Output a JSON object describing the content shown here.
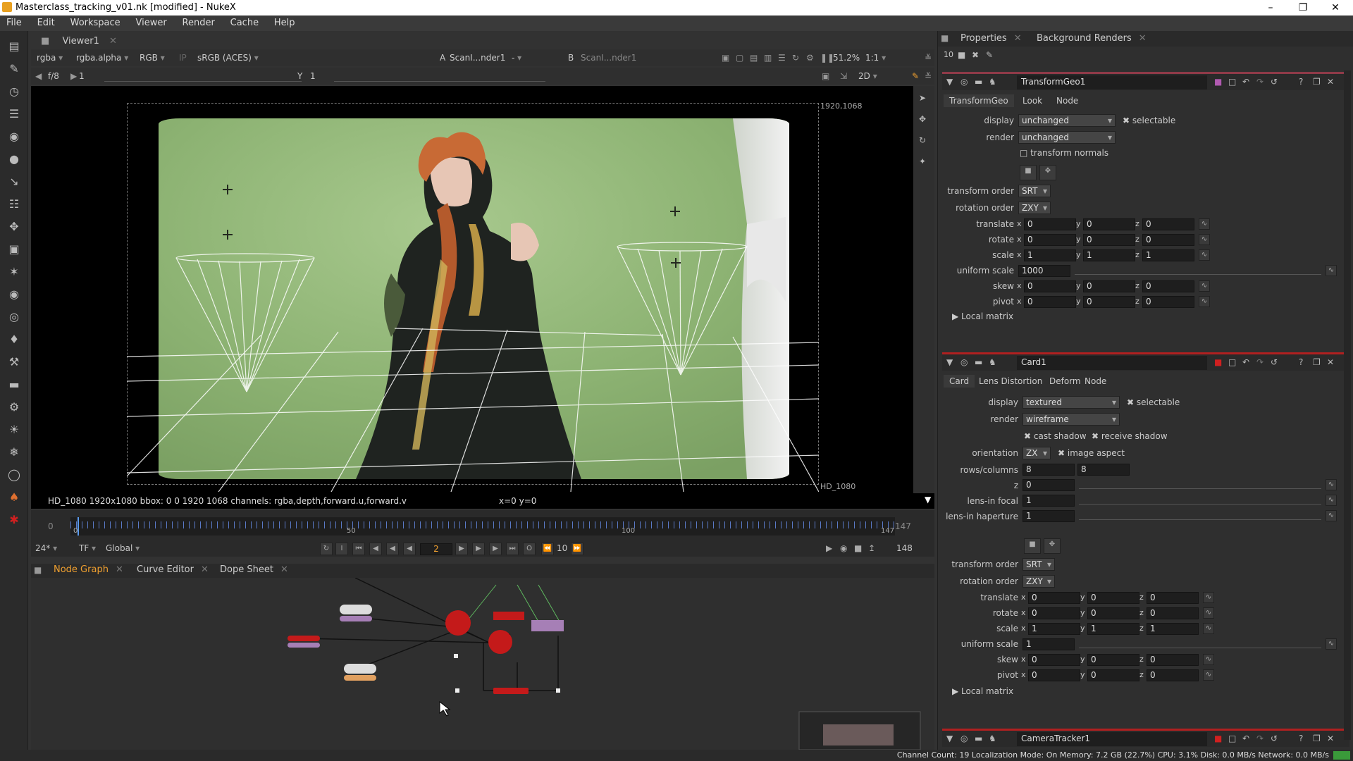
{
  "window": {
    "title": "Masterclass_tracking_v01.nk [modified] - NukeX"
  },
  "menu": [
    "File",
    "Edit",
    "Workspace",
    "Viewer",
    "Render",
    "Cache",
    "Help"
  ],
  "viewer_tabs": {
    "viewer": "Viewer1"
  },
  "viewer_toolbar": {
    "channels": "rgba",
    "alpha": "rgba.alpha",
    "rgb": "RGB",
    "ip": "IP",
    "colorspace": "sRGB (ACES)",
    "a_label": "A",
    "a_input": "ScanI...nder1",
    "a_op": "-",
    "b_label": "B",
    "b_input": "ScanI...nder1",
    "zoom": "51.2%",
    "ratio": "1:1"
  },
  "viewer_toolbar2": {
    "fstop": "f/8",
    "gain": "1",
    "gamma_label": "Y",
    "gamma": "1",
    "mode": "2D"
  },
  "viewer": {
    "corner_tr": "1920,1068",
    "format_br": "HD_1080"
  },
  "viewer_status": {
    "info": "HD_1080 1920x1080  bbox: 0 0 1920 1068 channels: rgba,depth,forward.u,forward.v",
    "coords": "x=0 y=0"
  },
  "timeline": {
    "start": "0",
    "ticks": [
      "0",
      "50",
      "100",
      "147"
    ],
    "end": "147",
    "fps": "24*",
    "tf": "TF",
    "global": "Global",
    "current_frame": "2",
    "step": "10",
    "last_frame": "148"
  },
  "bottom_tabs": [
    "Node Graph",
    "Curve Editor",
    "Dope Sheet"
  ],
  "props_tabs": [
    "Properties",
    "Background Renders"
  ],
  "props_count": "10",
  "transformgeo": {
    "name": "TransformGeo1",
    "tabs": [
      "TransformGeo",
      "Look",
      "Node"
    ],
    "display_label": "display",
    "display": "unchanged",
    "selectable": "selectable",
    "render_label": "render",
    "render": "unchanged",
    "transform_normals": "transform normals",
    "transform_order_label": "transform order",
    "transform_order": "SRT",
    "rotation_order_label": "rotation order",
    "rotation_order": "ZXY",
    "rows": [
      {
        "label": "translate",
        "x": "0",
        "y": "0",
        "z": "0"
      },
      {
        "label": "rotate",
        "x": "0",
        "y": "0",
        "z": "0"
      },
      {
        "label": "scale",
        "x": "1",
        "y": "1",
        "z": "1"
      },
      {
        "label": "skew",
        "x": "0",
        "y": "0",
        "z": "0"
      },
      {
        "label": "pivot",
        "x": "0",
        "y": "0",
        "z": "0"
      }
    ],
    "uniform_scale_label": "uniform scale",
    "uniform_scale": "1000",
    "local_matrix": "Local matrix"
  },
  "card": {
    "name": "Card1",
    "tabs": [
      "Card",
      "Lens Distortion",
      "Deform",
      "Node"
    ],
    "display_label": "display",
    "display": "textured",
    "selectable": "selectable",
    "render_label": "render",
    "render": "wireframe",
    "cast_shadow": "cast shadow",
    "receive_shadow": "receive shadow",
    "orientation_label": "orientation",
    "orientation": "ZX",
    "image_aspect": "image aspect",
    "rows_columns_label": "rows/columns",
    "rows": "8",
    "columns": "8",
    "z_label": "z",
    "z": "0",
    "lens_focal_label": "lens-in focal",
    "lens_focal": "1",
    "lens_haperture_label": "lens-in haperture",
    "lens_haperture": "1",
    "transform_order_label": "transform order",
    "transform_order": "SRT",
    "rotation_order_label": "rotation order",
    "rotation_order": "ZXY",
    "xyz_rows": [
      {
        "label": "translate",
        "x": "0",
        "y": "0",
        "z": "0"
      },
      {
        "label": "rotate",
        "x": "0",
        "y": "0",
        "z": "0"
      },
      {
        "label": "scale",
        "x": "1",
        "y": "1",
        "z": "1"
      },
      {
        "label": "skew",
        "x": "0",
        "y": "0",
        "z": "0"
      },
      {
        "label": "pivot",
        "x": "0",
        "y": "0",
        "z": "0"
      }
    ],
    "uniform_scale_label": "uniform scale",
    "uniform_scale": "1",
    "local_matrix": "Local matrix"
  },
  "cameratracker": {
    "name": "CameraTracker1"
  },
  "status_bar": "Channel Count: 19  Localization Mode: On  Memory: 7.2 GB (22.7%)  CPU: 3.1%  Disk: 0.0 MB/s  Network: 0.0 MB/s",
  "colors": {
    "accent": "#f0a030",
    "panel_red": "#8f3a48",
    "green_screen": "#8fb577",
    "node_red": "#c41a1a",
    "node_purple": "#a67fb6"
  }
}
